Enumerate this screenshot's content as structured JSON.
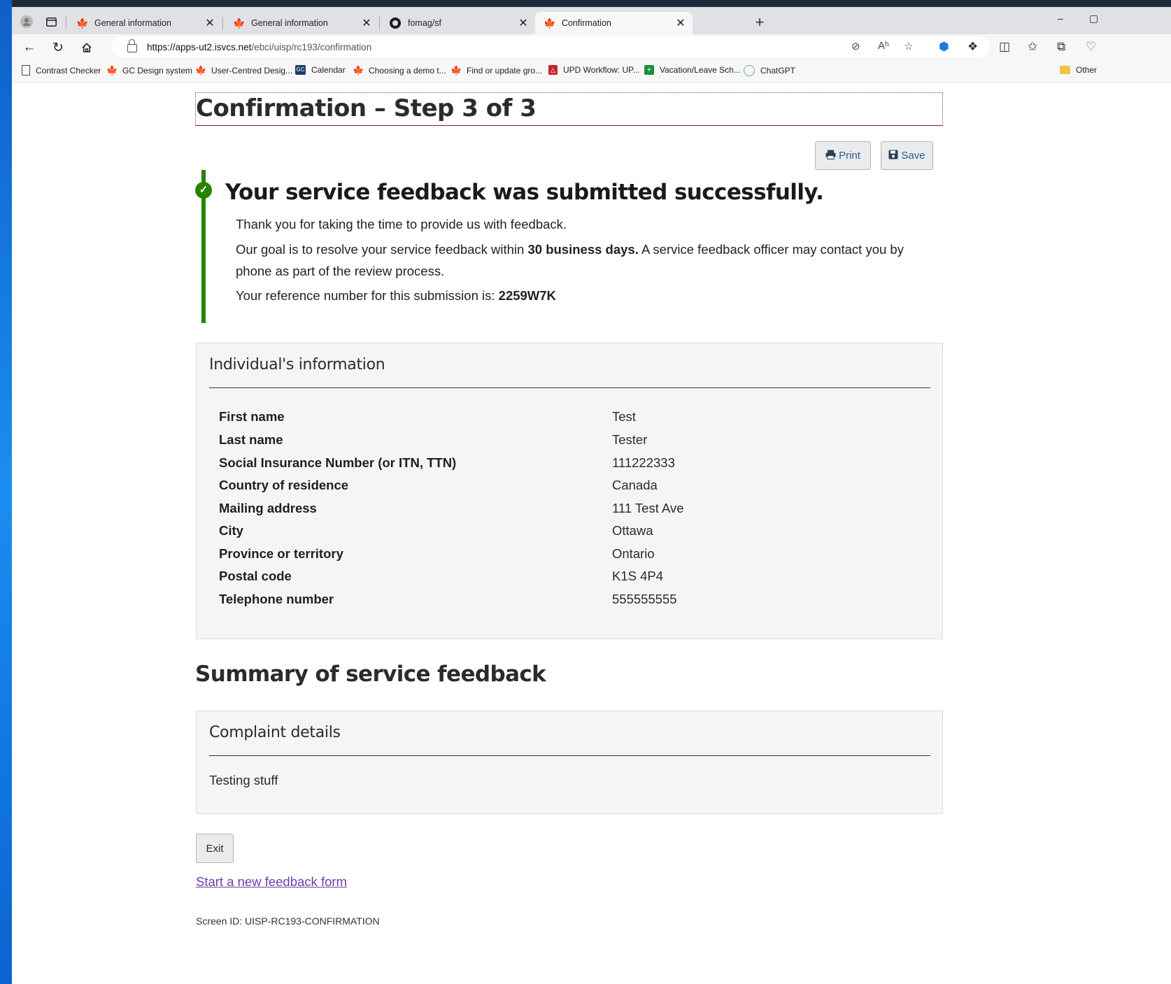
{
  "browser": {
    "tabs": [
      {
        "title": "General information",
        "icon": "maple-leaf-icon",
        "active": false
      },
      {
        "title": "General information",
        "icon": "maple-leaf-icon",
        "active": false
      },
      {
        "title": "fomag/sf",
        "icon": "github-icon",
        "active": false
      },
      {
        "title": "Confirmation",
        "icon": "maple-leaf-icon",
        "active": true
      }
    ],
    "url_host": "https://apps-ut2.isvcs.net",
    "url_path": "/ebci/uisp/rc193/confirmation",
    "bookmarks": [
      {
        "label": "Contrast Checker",
        "icon": "document-icon"
      },
      {
        "label": "GC Design system",
        "icon": "maple-leaf-icon"
      },
      {
        "label": "User-Centred Desig...",
        "icon": "maple-leaf-icon"
      },
      {
        "label": "Calendar",
        "icon": "gc-calendar-icon"
      },
      {
        "label": "Choosing a demo t...",
        "icon": "maple-leaf-icon"
      },
      {
        "label": "Find or update gro...",
        "icon": "maple-leaf-icon"
      },
      {
        "label": "UPD Workflow: UP...",
        "icon": "upd-icon"
      },
      {
        "label": "Vacation/Leave Sch...",
        "icon": "sheets-icon"
      },
      {
        "label": "ChatGPT",
        "icon": "chatgpt-icon"
      },
      {
        "label": "Other",
        "icon": "folder-icon"
      }
    ]
  },
  "page": {
    "title": "Confirmation – Step 3 of 3",
    "print_label": "Print",
    "save_label": "Save",
    "success": {
      "heading": "Your service feedback was submitted successfully.",
      "thanks": "Thank you for taking the time to provide us with feedback.",
      "goal_pre": "Our goal is to resolve your service feedback within ",
      "goal_bold": "30 business days.",
      "goal_post": " A service feedback officer may contact you by phone as part of the review process.",
      "ref_pre": "Your reference number for this submission is: ",
      "ref_number": "2259W7K"
    },
    "individual": {
      "heading": "Individual's information",
      "rows": [
        {
          "label": "First name",
          "value": "Test"
        },
        {
          "label": "Last name",
          "value": "Tester"
        },
        {
          "label": "Social Insurance Number (or ITN, TTN)",
          "value": "111222333"
        },
        {
          "label": "Country of residence",
          "value": "Canada"
        },
        {
          "label": "Mailing address",
          "value": "111 Test Ave"
        },
        {
          "label": "City",
          "value": "Ottawa"
        },
        {
          "label": "Province or territory",
          "value": "Ontario"
        },
        {
          "label": "Postal code",
          "value": "K1S 4P4"
        },
        {
          "label": "Telephone number",
          "value": "555555555"
        }
      ]
    },
    "summary_heading": "Summary of service feedback",
    "complaint": {
      "heading": "Complaint details",
      "text": "Testing stuff"
    },
    "exit_label": "Exit",
    "new_form_link": "Start a new feedback form",
    "screen_id": "Screen ID: UISP-RC193-CONFIRMATION"
  }
}
